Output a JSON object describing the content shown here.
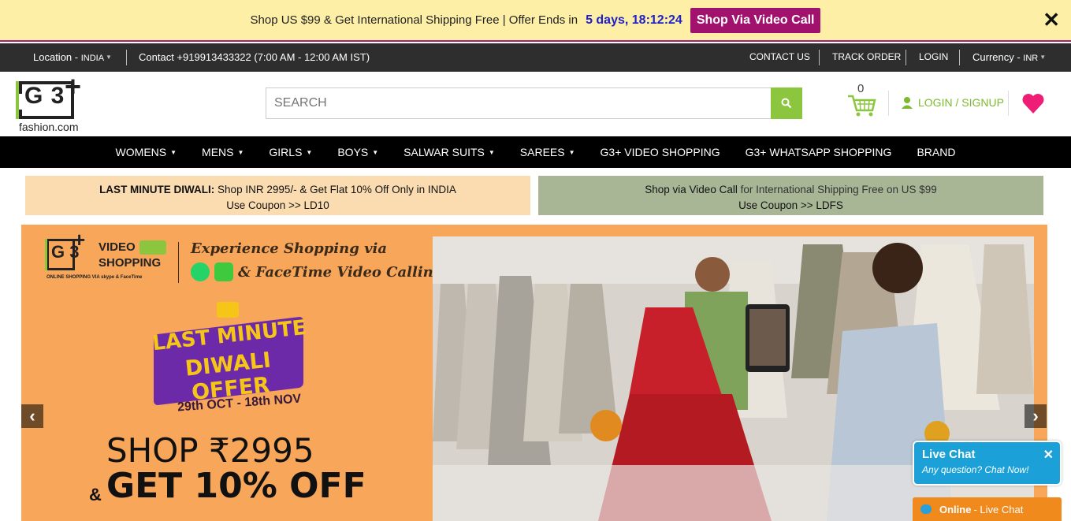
{
  "promo": {
    "text": "Shop US $99 & Get International Shipping Free | Offer Ends in",
    "countdown": "5 days, 18:12:24",
    "button": "Shop Via Video Call",
    "close_icon": "close-icon"
  },
  "topbar": {
    "location_label": "Location - ",
    "location_value": "INDIA",
    "contact": "Contact +919913433322 (7:00 AM - 12:00 AM IST)",
    "contact_us": "CONTACT US",
    "track_order": "TRACK ORDER",
    "login": "LOGIN",
    "currency_label": "Currency - ",
    "currency_value": "INR"
  },
  "header": {
    "logo_text": "G 3",
    "logo_plus": "+",
    "logo_sub": "fashion.com",
    "search_placeholder": "SEARCH",
    "cart_count": "0",
    "login_signup": "LOGIN / SIGNUP"
  },
  "nav": {
    "items": [
      {
        "label": "WOMENS",
        "dropdown": true
      },
      {
        "label": "MENS",
        "dropdown": true
      },
      {
        "label": "GIRLS",
        "dropdown": true
      },
      {
        "label": "BOYS",
        "dropdown": true
      },
      {
        "label": "SALWAR SUITS",
        "dropdown": true
      },
      {
        "label": "SAREES",
        "dropdown": true
      },
      {
        "label": "G3+ VIDEO SHOPPING",
        "dropdown": false
      },
      {
        "label": "G3+ WHATSAPP SHOPPING",
        "dropdown": false
      },
      {
        "label": "BRAND",
        "dropdown": false
      }
    ]
  },
  "offers": {
    "left_bold": "LAST MINUTE DIWALI:",
    "left_text": " Shop INR 2995/- & Get Flat 10% Off Only in INDIA",
    "left_coupon": "Use Coupon >> LD10",
    "right_dark": "Shop via Video Call",
    "right_text": " for International Shipping Free on US $99",
    "right_coupon": "Use Coupon >> LDFS"
  },
  "banner": {
    "brand_g3": "G 3",
    "brand_video": "VIDEO",
    "brand_shopping": "SHOPPING",
    "brand_sub": "ONLINE SHOPPING VIA skype & FaceTime",
    "headline1": "Experience Shopping via",
    "headline2": "& FaceTime Video Calling",
    "badge1": "LAST MINUTE",
    "badge2": "DIWALI OFFER",
    "dates": "29th OCT - 18th NOV",
    "shop": "SHOP ₹2995",
    "amp": "&",
    "get": "GET 10% OFF"
  },
  "chat": {
    "title": "Live Chat",
    "subtitle": "Any question? Chat Now!",
    "bar_bold": "Online",
    "bar_text": " - Live Chat"
  }
}
